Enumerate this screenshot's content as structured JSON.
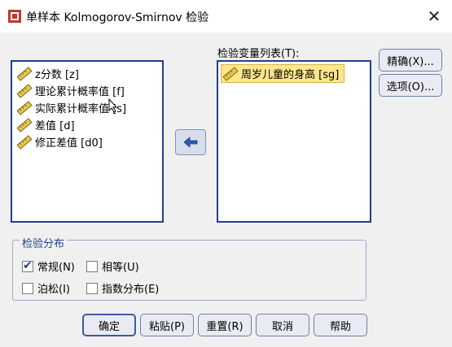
{
  "window": {
    "title": "单样本 Kolmogorov-Smirnov 检验",
    "close_glyph": "✕"
  },
  "source_list": {
    "items": [
      {
        "label": "z分数 [z]"
      },
      {
        "label": "理论累计概率值 [f]"
      },
      {
        "label": "实际累计概率值 [s]"
      },
      {
        "label": "差值 [d]"
      },
      {
        "label": "修正差值 [d0]"
      }
    ]
  },
  "target_list": {
    "label": "检验变量列表(T):",
    "items": [
      {
        "label": "周岁儿童的身高 [sg]",
        "selected": true
      }
    ]
  },
  "side_buttons": {
    "exact": "精确(X)...",
    "options": "选项(O)..."
  },
  "test_distribution": {
    "title": "检验分布",
    "options": [
      {
        "label": "常规(N)",
        "checked": true
      },
      {
        "label": "相等(U)",
        "checked": false
      },
      {
        "label": "泊松(I)",
        "checked": false
      },
      {
        "label": "指数分布(E)",
        "checked": false
      }
    ]
  },
  "footer_buttons": {
    "ok": "确定",
    "paste": "粘贴(P)",
    "reset": "重置(R)",
    "cancel": "取消",
    "help": "帮助"
  },
  "icons": {
    "variable": "ruler-scale-icon",
    "move": "arrow-left-icon"
  },
  "colors": {
    "accent": "#1f3f93",
    "selection": "#ffe68a"
  }
}
